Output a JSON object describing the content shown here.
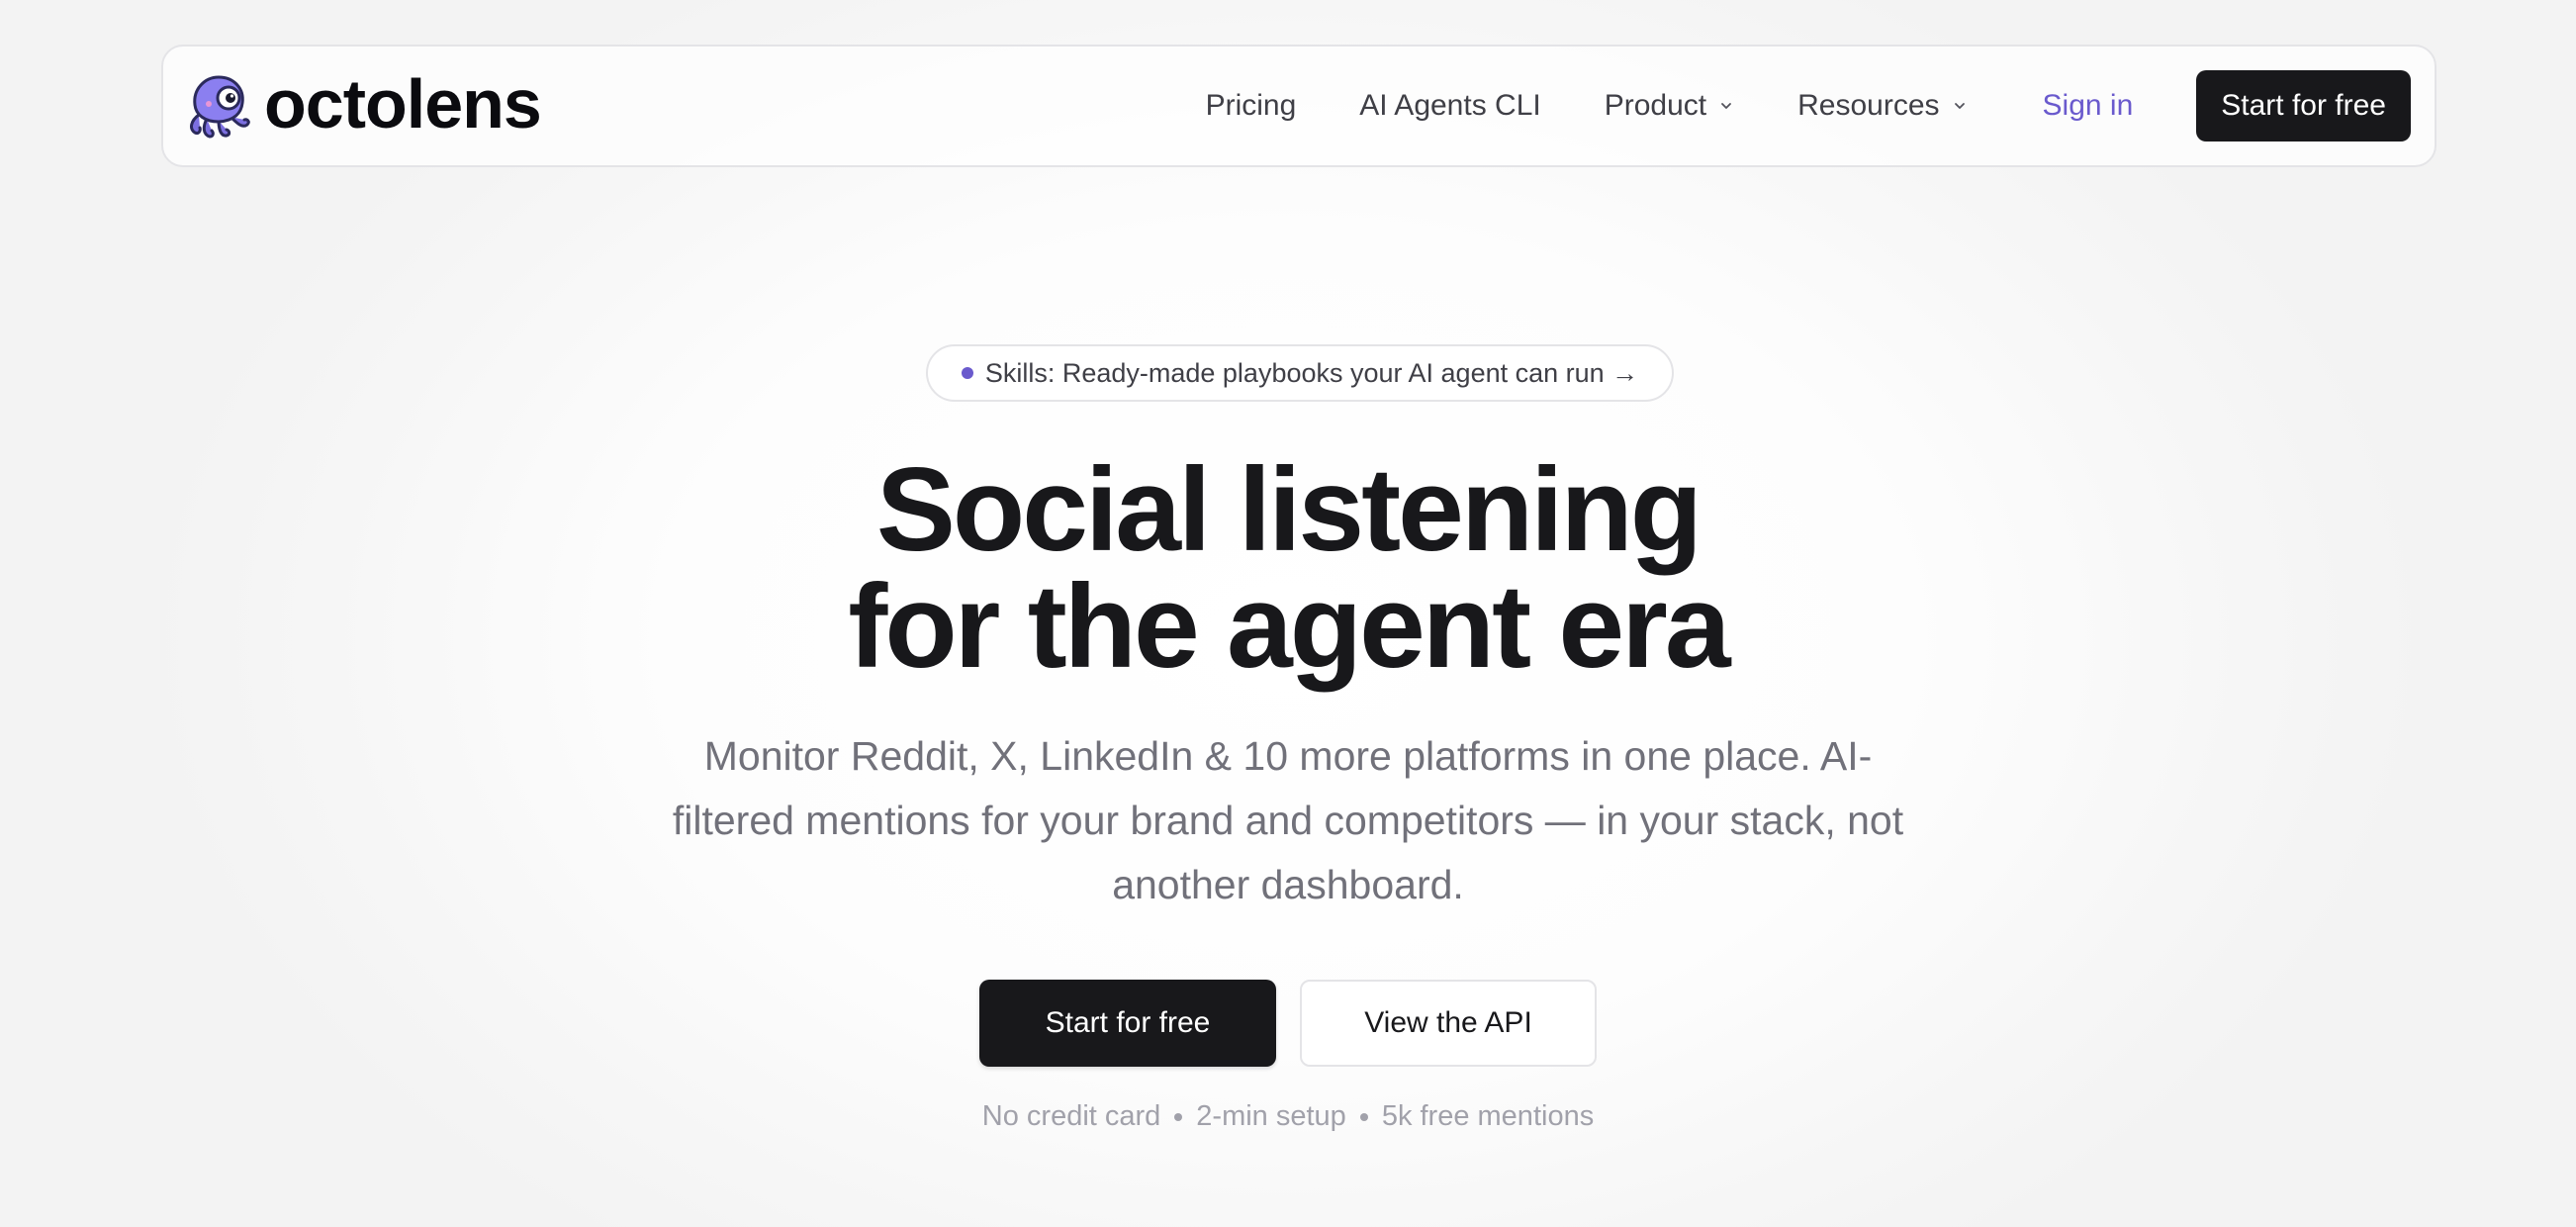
{
  "brand": {
    "name": "octolens",
    "logo_icon": "octopus-icon",
    "accent_color": "#6a5acd"
  },
  "nav": {
    "links": {
      "pricing": "Pricing",
      "ai_agents_cli": "AI Agents CLI",
      "product": "Product",
      "resources": "Resources"
    },
    "sign_in": "Sign in",
    "cta": "Start for free"
  },
  "hero": {
    "announcement": "Skills: Ready-made playbooks your AI agent can run →",
    "headline_line1": "Social listening",
    "headline_line2": "for the agent era",
    "subheadline": "Monitor Reddit, X, LinkedIn & 10 more platforms in one place. AI-filtered mentions for your brand and competitors — in your stack, not another dashboard.",
    "primary_cta": "Start for free",
    "secondary_cta": "View the API",
    "features": [
      "No credit card",
      "2-min setup",
      "5k free mentions"
    ]
  }
}
